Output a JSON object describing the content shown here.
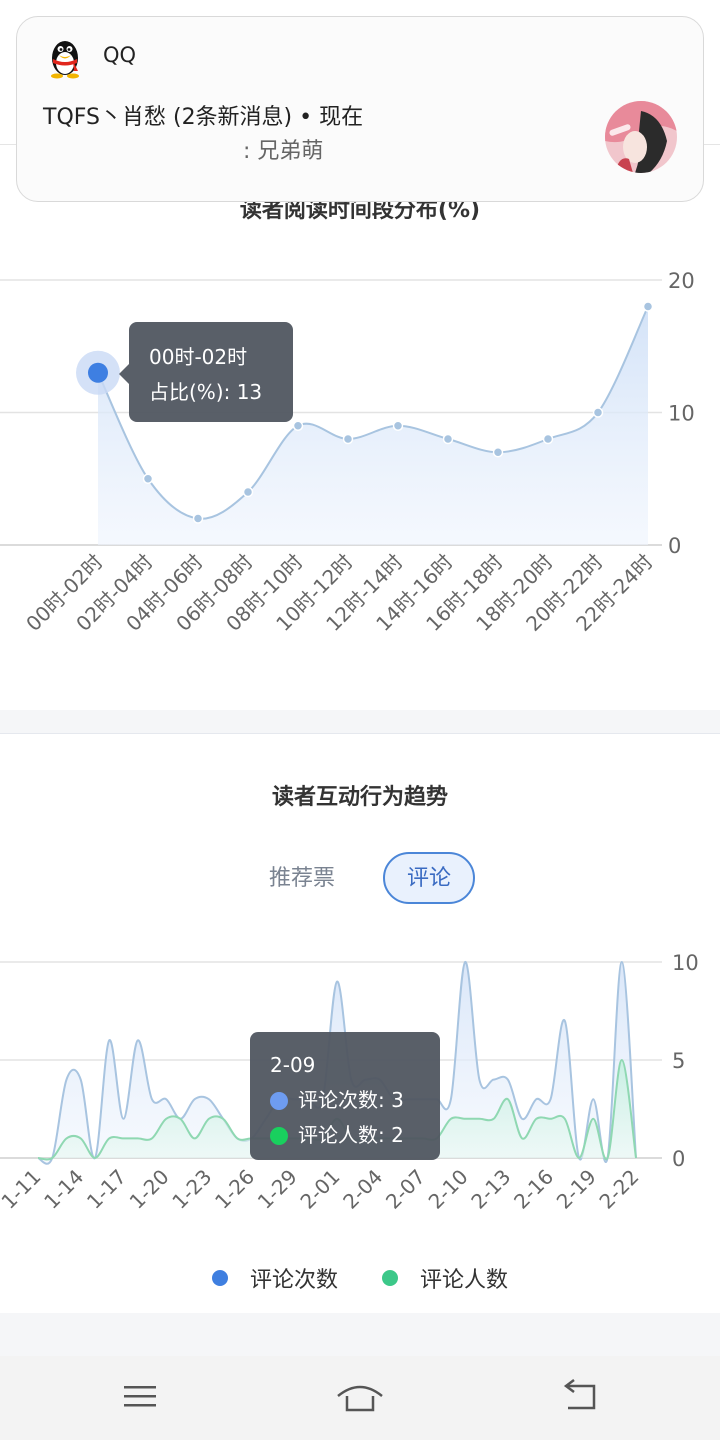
{
  "notification": {
    "app_name": "QQ",
    "title": "TQFS丶肖愁 (2条新消息) • 现在",
    "body": ": 兄弟萌"
  },
  "reading_chart": {
    "title": "读者阅读时间段分布(%)",
    "tooltip": {
      "label": "00时-02时",
      "line": "占比(%): 13"
    },
    "chart_data": {
      "type": "area",
      "title": "读者阅读时间段分布(%)",
      "categories": [
        "00时-02时",
        "02时-04时",
        "04时-06时",
        "06时-08时",
        "08时-10时",
        "10时-12时",
        "12时-14时",
        "14时-16时",
        "16时-18时",
        "18时-20时",
        "20时-22时",
        "22时-24时"
      ],
      "values": [
        13,
        5,
        2,
        4,
        9,
        8,
        9,
        8,
        7,
        8,
        10,
        18
      ],
      "ylim": [
        0,
        20
      ],
      "yticks": [
        "0",
        "10",
        "20"
      ],
      "grid": true,
      "color": "#a8c4e0"
    }
  },
  "interaction_chart": {
    "title": "读者互动行为趋势",
    "tabs": [
      {
        "label": "推荐票",
        "active": false
      },
      {
        "label": "评论",
        "active": true
      }
    ],
    "tooltip": {
      "label": "2-09",
      "rows": [
        {
          "text": "评论次数: 3",
          "color": "#6e9cf0"
        },
        {
          "text": "评论人数: 2",
          "color": "#19d05e"
        }
      ]
    },
    "legend": [
      {
        "label": "评论次数",
        "color": "#3f7fe0"
      },
      {
        "label": "评论人数",
        "color": "#3cc889"
      }
    ],
    "chart_data": {
      "type": "area",
      "title": "读者互动行为趋势",
      "x": [
        "1-11",
        "1-12",
        "1-13",
        "1-14",
        "1-15",
        "1-16",
        "1-17",
        "1-18",
        "1-19",
        "1-20",
        "1-21",
        "1-22",
        "1-23",
        "1-24",
        "1-25",
        "1-26",
        "1-27",
        "1-28",
        "1-29",
        "1-30",
        "1-31",
        "2-01",
        "2-02",
        "2-03",
        "2-04",
        "2-05",
        "2-06",
        "2-07",
        "2-08",
        "2-09",
        "2-10",
        "2-11",
        "2-12",
        "2-13",
        "2-14",
        "2-15",
        "2-16",
        "2-17",
        "2-18",
        "2-19",
        "2-20",
        "2-21",
        "2-22"
      ],
      "xticks": [
        "1-11",
        "1-14",
        "1-17",
        "1-20",
        "1-23",
        "1-26",
        "1-29",
        "2-01",
        "2-04",
        "2-07",
        "2-10",
        "2-13",
        "2-16",
        "2-19",
        "2-22"
      ],
      "series": [
        {
          "name": "评论次数",
          "color": "#a8c4e0",
          "values": [
            0,
            0,
            4,
            4,
            0,
            6,
            2,
            6,
            3,
            3,
            2,
            3,
            3,
            2,
            1,
            1,
            2,
            3,
            3,
            3,
            3,
            9,
            4,
            4,
            4,
            3,
            3,
            3,
            3,
            3,
            10,
            4,
            4,
            4,
            2,
            3,
            3,
            7,
            0,
            3,
            0,
            10,
            0
          ]
        },
        {
          "name": "评论人数",
          "color": "#8fd8b2",
          "values": [
            0,
            0,
            1,
            1,
            0,
            1,
            1,
            1,
            1,
            2,
            2,
            1,
            2,
            2,
            1,
            1,
            1,
            1,
            1,
            1,
            1,
            2,
            1,
            1,
            1,
            1,
            1,
            1,
            1,
            2,
            2,
            2,
            2,
            3,
            1,
            2,
            2,
            2,
            0,
            2,
            0,
            5,
            0
          ]
        }
      ],
      "ylim": [
        0,
        10
      ],
      "yticks": [
        "0",
        "5",
        "10"
      ],
      "grid": true
    }
  },
  "navbar": {
    "menu": "menu-icon",
    "home": "home-icon",
    "back": "back-icon"
  }
}
